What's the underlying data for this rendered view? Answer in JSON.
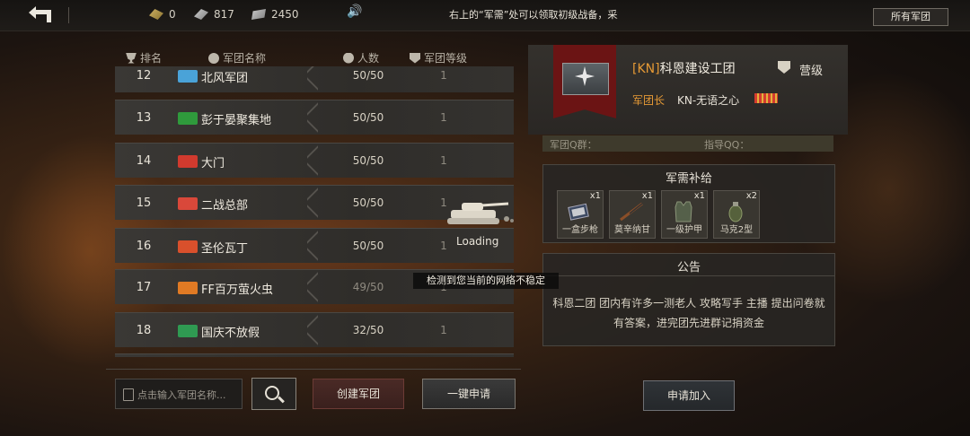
{
  "topbar": {
    "gold": "0",
    "steel": "817",
    "tickets": "2450",
    "marquee": "右上的“军需”处可以领取初级战备，采集",
    "all_legions": "所有军团"
  },
  "list": {
    "headers": {
      "rank": "排名",
      "name": "军团名称",
      "members": "人数",
      "level": "军团等级"
    },
    "rows": [
      {
        "rank": "12",
        "name": "北风军团",
        "members": "50/50",
        "level": "1",
        "flag_color": "#4aa3d8"
      },
      {
        "rank": "13",
        "name": "彭于晏聚集地",
        "members": "50/50",
        "level": "1",
        "flag_color": "#2f9a3c"
      },
      {
        "rank": "14",
        "name": "大门",
        "members": "50/50",
        "level": "1",
        "flag_color": "#d13a2e"
      },
      {
        "rank": "15",
        "name": "二战总部",
        "members": "50/50",
        "level": "1",
        "flag_color": "#d9483a"
      },
      {
        "rank": "16",
        "name": "圣伦瓦丁",
        "members": "50/50",
        "level": "1",
        "flag_color": "#d9502c"
      },
      {
        "rank": "17",
        "name": "FF百万萤火虫",
        "members": "49/50",
        "level": "1",
        "flag_color": "#e07a24"
      },
      {
        "rank": "18",
        "name": "国庆不放假",
        "members": "32/50",
        "level": "1",
        "flag_color": "#2f9a52"
      }
    ]
  },
  "search": {
    "placeholder": "点击输入军团名称..."
  },
  "buttons": {
    "create": "创建军团",
    "apply_all": "一键申请",
    "join": "申请加入"
  },
  "legion": {
    "tag": "[KN]",
    "name": "科恩建设工团",
    "rank": "营级",
    "leader_label": "军团长",
    "leader_name": "KN-无语之心",
    "qq_group": "军团Q群：",
    "guide_qq": "指导QQ："
  },
  "supply": {
    "title": "军需补给",
    "items": [
      {
        "label": "一盒步枪",
        "count": "x1"
      },
      {
        "label": "莫辛纳甘",
        "count": "x1"
      },
      {
        "label": "一级护甲",
        "count": "x1"
      },
      {
        "label": "马克2型",
        "count": "x2"
      }
    ]
  },
  "notice": {
    "title": "公告",
    "text": "科恩二团 团内有许多一测老人 攻略写手 主播 提出问卷就有答案，进完团先进群记捐资金"
  },
  "overlay": {
    "loading": "Loading",
    "toast": "检测到您当前的网络不稳定"
  }
}
